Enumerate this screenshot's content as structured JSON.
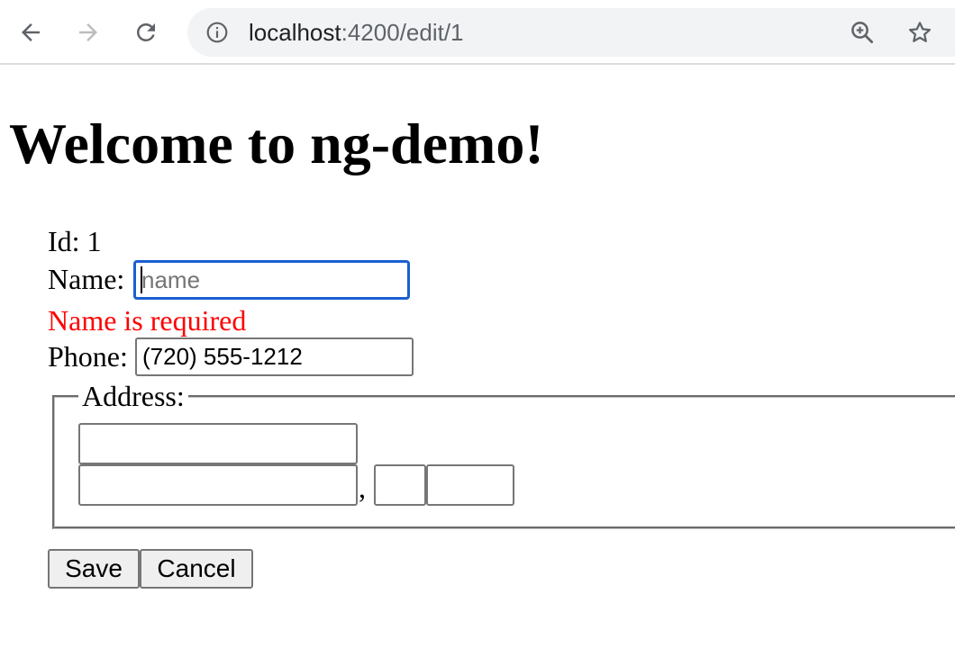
{
  "browser": {
    "url_host": "localhost",
    "url_rest": ":4200/edit/1",
    "icons": [
      "back-arrow-icon",
      "forward-arrow-icon",
      "reload-icon",
      "info-icon",
      "zoom-icon",
      "star-icon"
    ],
    "colors": {
      "omnibox_bg": "#f1f3f4",
      "focus_ring": "#1a5fd1"
    }
  },
  "page": {
    "title": "Welcome to ng-demo!"
  },
  "form": {
    "id_label": "Id:",
    "id_value": "1",
    "name_label": "Name:",
    "name_value": "",
    "name_placeholder": "name",
    "name_error": "Name is required",
    "error_color": "#ff0000",
    "phone_label": "Phone:",
    "phone_value": "(720) 555-1212",
    "address_legend": "Address:",
    "street1_value": "",
    "street2_value": "",
    "separator": ",",
    "state_value": "",
    "zip_value": ""
  },
  "actions": {
    "save_label": "Save",
    "cancel_label": "Cancel"
  }
}
